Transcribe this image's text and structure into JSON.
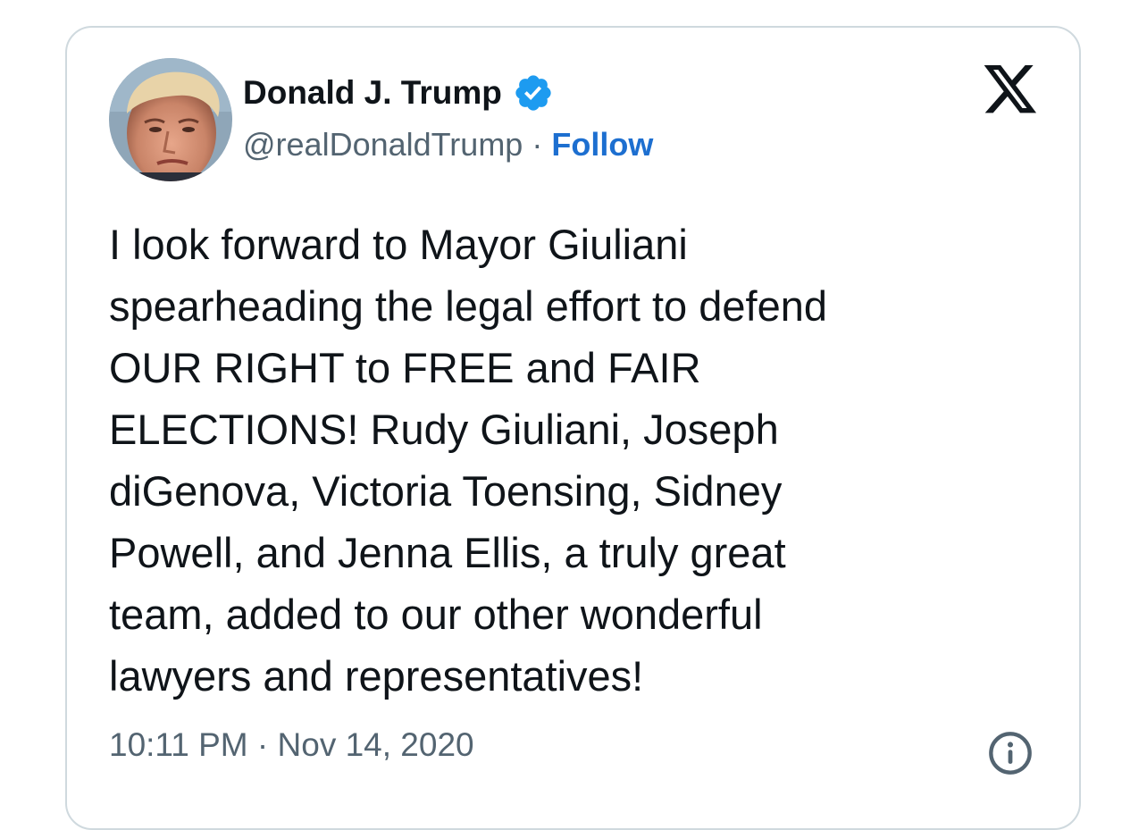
{
  "author": {
    "display_name": "Donald J. Trump",
    "handle": "@realDonaldTrump",
    "separator": "·",
    "follow_label": "Follow",
    "avatar_icon": "profile-photo",
    "verified_icon": "verified-badge-icon"
  },
  "brand": {
    "logo_icon": "x-logo-icon"
  },
  "tweet": {
    "lines": [
      "I look forward to Mayor Giuliani",
      "spearheading the legal effort to defend",
      "OUR RIGHT to FREE and FAIR",
      "ELECTIONS! Rudy Giuliani, Joseph",
      "diGenova, Victoria Toensing, Sidney",
      "Powell, and Jenna Ellis, a truly great",
      "team, added to our other wonderful",
      "lawyers and representatives!"
    ],
    "time": "10:11 PM",
    "separator": "·",
    "date": "Nov 14, 2020"
  },
  "colors": {
    "accent": "#1d9bf0",
    "link": "#1d6fd0",
    "text": "#0f1419",
    "secondary": "#536471",
    "border": "#cfd9de"
  }
}
